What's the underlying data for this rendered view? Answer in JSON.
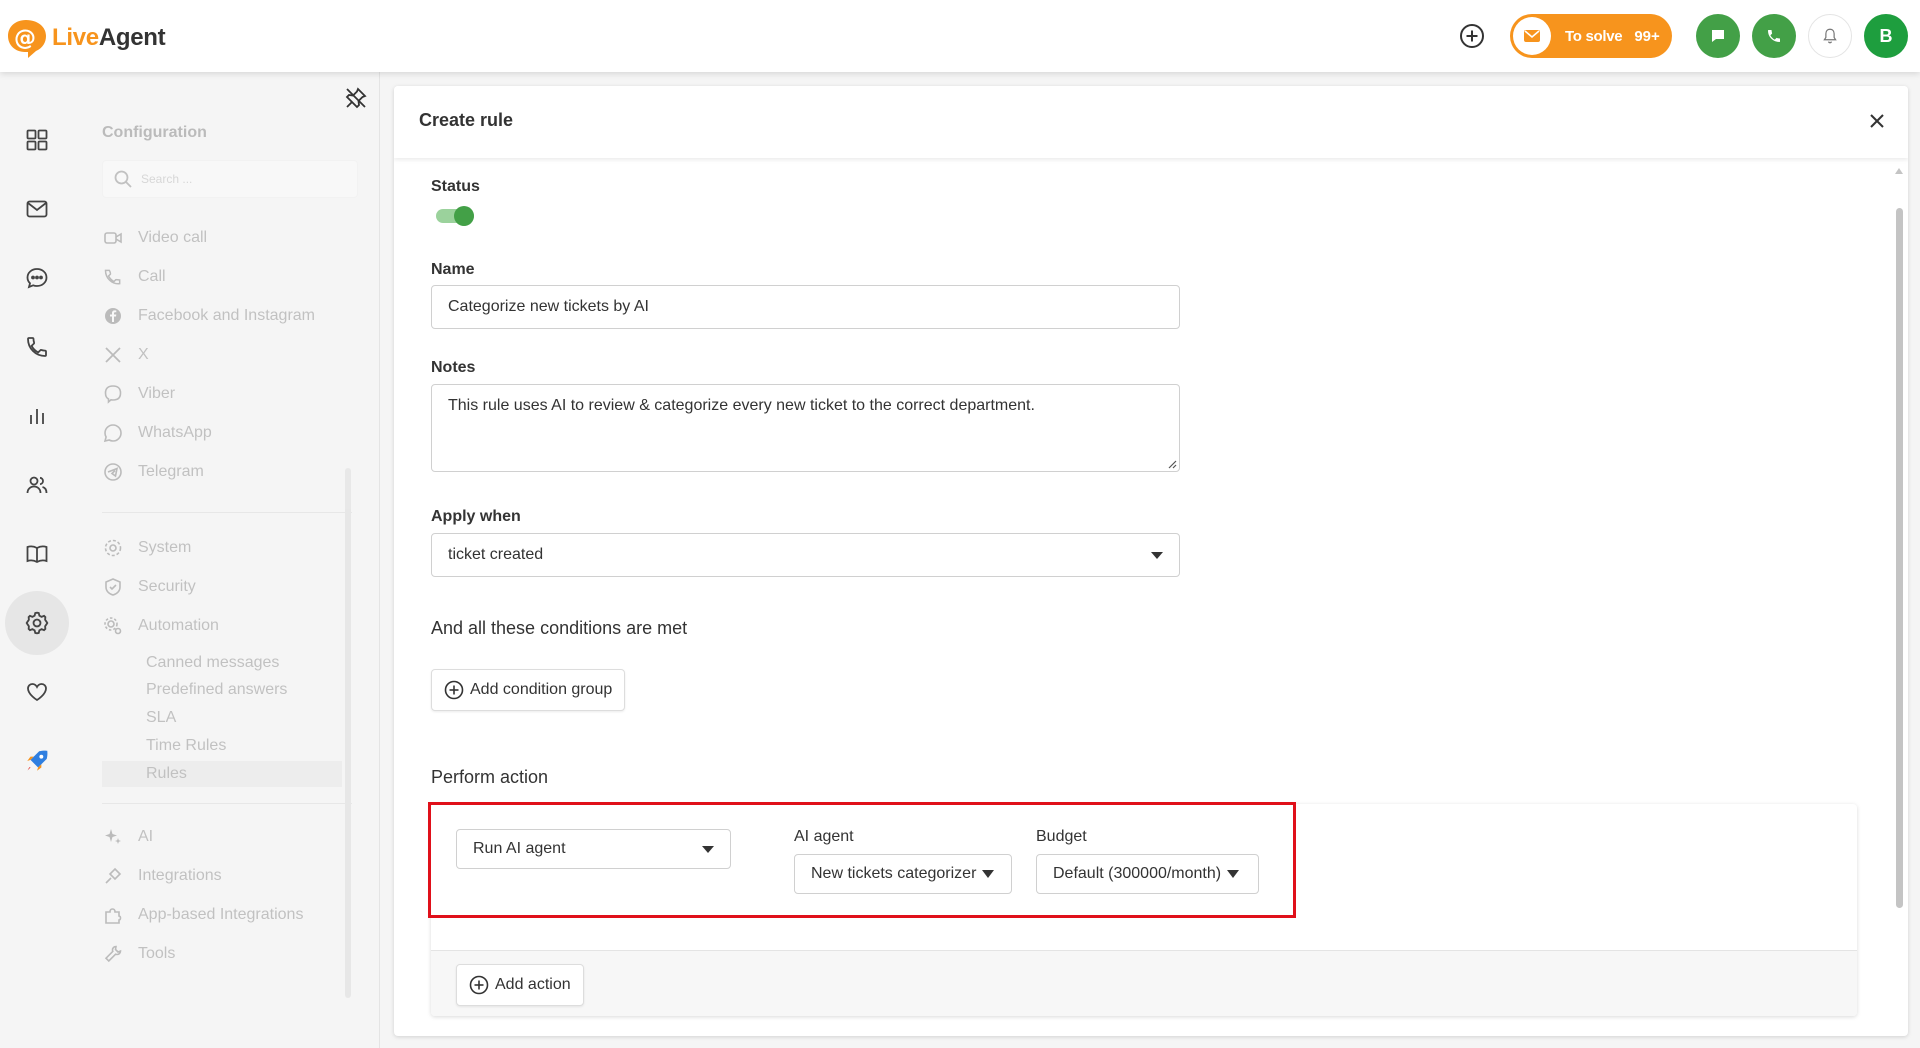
{
  "app": {
    "logo_live": "Live",
    "logo_agent": "Agent",
    "to_solve_label": "To solve",
    "to_solve_count": "99+",
    "user_initial": "B",
    "brand_orange": "#f7941d",
    "brand_green": "#43a047"
  },
  "config": {
    "title": "Configuration",
    "search_placeholder": "Search ...",
    "channels": [
      {
        "label": "Video call",
        "icon": "video-call-icon"
      },
      {
        "label": "Call",
        "icon": "call-gear-icon"
      },
      {
        "label": "Facebook and Instagram",
        "icon": "facebook-icon"
      },
      {
        "label": "X",
        "icon": "x-icon"
      },
      {
        "label": "Viber",
        "icon": "viber-icon"
      },
      {
        "label": "WhatsApp",
        "icon": "whatsapp-icon"
      },
      {
        "label": "Telegram",
        "icon": "telegram-icon"
      }
    ],
    "system": [
      {
        "label": "System",
        "icon": "gear-icon"
      },
      {
        "label": "Security",
        "icon": "shield-icon"
      },
      {
        "label": "Automation",
        "icon": "automation-icon"
      }
    ],
    "automation_sub": [
      "Canned messages",
      "Predefined answers",
      "SLA",
      "Time Rules",
      "Rules"
    ],
    "other": [
      {
        "label": "AI",
        "icon": "sparkle-icon"
      },
      {
        "label": "Integrations",
        "icon": "plug-icon"
      },
      {
        "label": "App-based Integrations",
        "icon": "puzzle-icon"
      },
      {
        "label": "Tools",
        "icon": "tools-icon"
      }
    ]
  },
  "dialog": {
    "title": "Create rule",
    "status_label": "Status",
    "name_label": "Name",
    "name_value": "Categorize new tickets by AI",
    "notes_label": "Notes",
    "notes_value": "This rule uses AI to review & categorize every new ticket to the correct department.",
    "apply_when_label": "Apply when",
    "apply_when_value": "ticket created",
    "conditions_heading": "And all these conditions are met",
    "add_condition_group": "Add condition group",
    "perform_action_heading": "Perform action",
    "action_type": "Run AI agent",
    "ai_agent_label": "AI agent",
    "ai_agent_value": "New tickets categorizer",
    "budget_label": "Budget",
    "budget_value": "Default (300000/month)",
    "add_action": "Add action"
  }
}
